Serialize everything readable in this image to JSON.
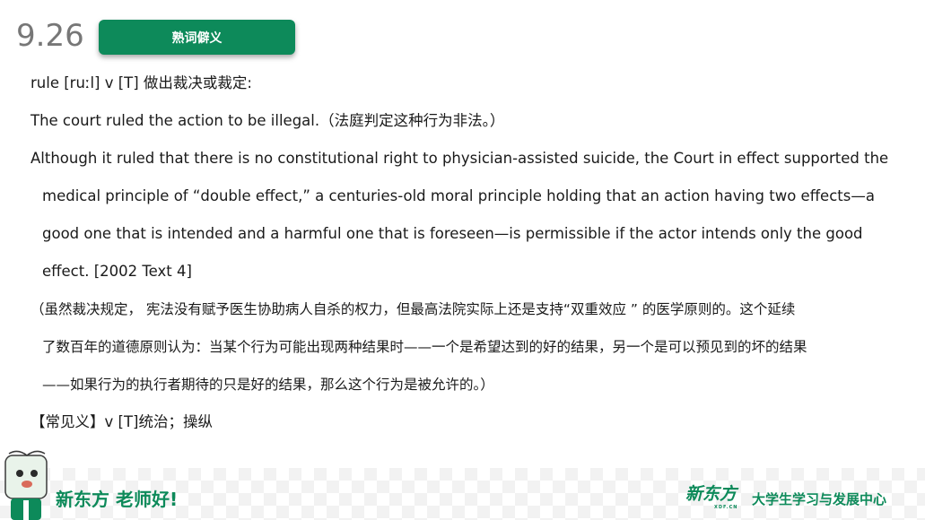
{
  "header": {
    "date": "9.26",
    "badge": "熟词僻义"
  },
  "content": {
    "definition": "rule [ruːl] v [T] 做出裁决或裁定:",
    "example_en": "The court ruled the action to be illegal.（法庭判定这种行为非法。）",
    "passage_lines": [
      "Although it ruled that there is no constitutional right to physician-assisted suicide, the Court in effect supported the",
      "medical principle of  “double effect,”  a centuries-old moral principle holding that an action having two effects—a",
      "good one that is intended and a harmful one that is foreseen—is permissible if the actor intends only the good",
      "effect. [2002 Text 4]"
    ],
    "translation_lines": [
      "（虽然裁决规定， 宪法没有赋予医生协助病人自杀的权力，但最高法院实际上还是支持“双重效应 ” 的医学原则的。这个延续",
      "了数百年的道德原则认为：当某个行为可能出现两种结果时——一个是希望达到的好的结果，另一个是可以预见到的坏的结果",
      "——如果行为的执行者期待的只是好的结果，那么这个行为是被允许的。）"
    ],
    "common_meaning": "【常见义】v [T]统治；操纵"
  },
  "footer": {
    "slogan": "新东方 老师好!",
    "logo_text": "新东方",
    "logo_sub": "XDF.CN",
    "center_name": "大学生学习与发展中心"
  },
  "colors": {
    "brand_green": "#0d8a5a",
    "date_gray": "#777777"
  }
}
